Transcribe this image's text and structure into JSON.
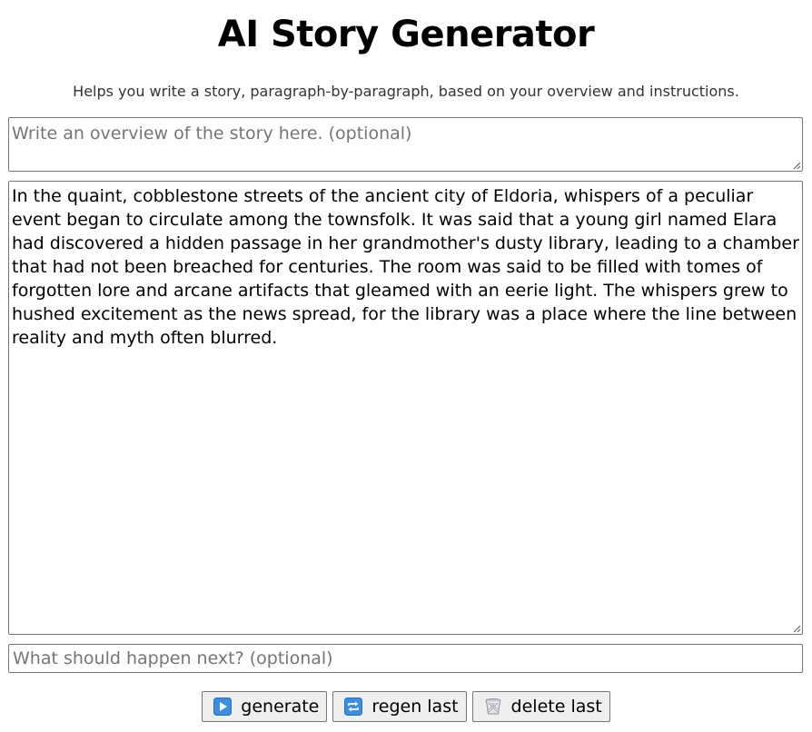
{
  "header": {
    "title": "AI Story Generator",
    "subtitle": "Helps you write a story, paragraph-by-paragraph, based on your overview and instructions."
  },
  "overview": {
    "placeholder": "Write an overview of the story here. (optional)",
    "value": ""
  },
  "story": {
    "value": "In the quaint, cobblestone streets of the ancient city of Eldoria, whispers of a peculiar event began to circulate among the townsfolk. It was said that a young girl named Elara had discovered a hidden passage in her grandmother's dusty library, leading to a chamber that had not been breached for centuries. The room was said to be filled with tomes of forgotten lore and arcane artifacts that gleamed with an eerie light. The whispers grew to hushed excitement as the news spread, for the library was a place where the line between reality and myth often blurred."
  },
  "next": {
    "placeholder": "What should happen next? (optional)",
    "value": ""
  },
  "buttons": {
    "generate": {
      "label": "generate",
      "icon": "play-icon"
    },
    "regen": {
      "label": "regen last",
      "icon": "repeat-icon"
    },
    "delete": {
      "label": "delete last",
      "icon": "wastebasket-icon"
    }
  },
  "colors": {
    "generate_icon": "#3c8ede",
    "regen_icon": "#3c8ede",
    "delete_icon": "#a9a9b8"
  }
}
